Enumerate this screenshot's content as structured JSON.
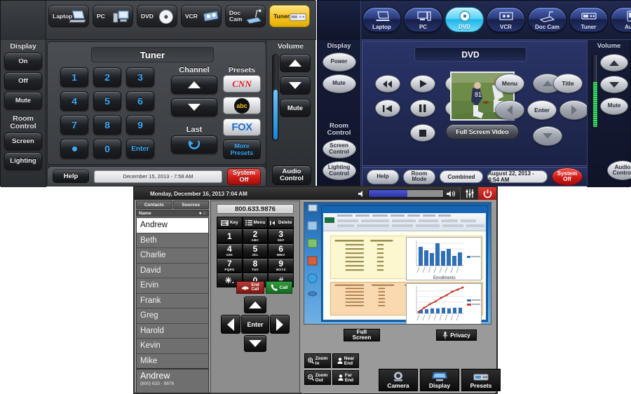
{
  "panel1": {
    "sources": [
      {
        "label": "Laptop",
        "icon": "laptop-icon",
        "selected": false
      },
      {
        "label": "PC",
        "icon": "desktop-pc-icon",
        "selected": false
      },
      {
        "label": "DVD",
        "icon": "disc-icon",
        "selected": false
      },
      {
        "label": "VCR",
        "icon": "vcr-tape-icon",
        "selected": false
      },
      {
        "label": "Doc\nCam",
        "icon": "document-camera-icon",
        "selected": false
      },
      {
        "label": "Tuner",
        "icon": "tuner-receiver-icon",
        "selected": true
      }
    ],
    "left": {
      "display_header": "Display",
      "display_buttons": [
        "On",
        "Off",
        "Mute"
      ],
      "room_header": "Room\nControl",
      "room_buttons": [
        "Screen",
        "Lighting"
      ]
    },
    "title": "Tuner",
    "keypad": [
      "1",
      "2",
      "3",
      "4",
      "5",
      "6",
      "7",
      "8",
      "9",
      "•",
      "0",
      "Enter"
    ],
    "channel_label": "Channel",
    "last_label": "Last",
    "presets_label": "Presets",
    "presets": [
      "CNN",
      "abc",
      "FOX"
    ],
    "more_presets": "More\nPresets",
    "bottom": {
      "help": "Help",
      "datetime": "December 15, 2013   -  7:58 AM",
      "system_off": "System\nOff"
    },
    "right": {
      "volume_header": "Volume",
      "mute": "Mute",
      "audio_control": "Audio\nControl",
      "volume_level_pct": 58
    }
  },
  "panel2": {
    "sources": [
      {
        "label": "Laptop",
        "icon": "laptop-icon",
        "selected": false
      },
      {
        "label": "PC",
        "icon": "desktop-pc-icon",
        "selected": false
      },
      {
        "label": "DVD",
        "icon": "disc-icon",
        "selected": true
      },
      {
        "label": "VCR",
        "icon": "vcr-tape-icon",
        "selected": false
      },
      {
        "label": "Doc Cam",
        "icon": "document-camera-icon",
        "selected": false
      },
      {
        "label": "Tuner",
        "icon": "tuner-receiver-icon",
        "selected": false
      },
      {
        "label": "Aux",
        "icon": "aux-device-icon",
        "selected": false
      }
    ],
    "left": {
      "display_header": "Display",
      "display_buttons": [
        "Power",
        "Mute"
      ],
      "room_header": "Room\nControl",
      "room_buttons": [
        "Screen\nControl",
        "Lighting\nControl"
      ]
    },
    "title": "DVD",
    "transport": [
      "rewind-icon",
      "play-icon",
      "fast-forward-icon",
      "previous-track-icon",
      "pause-icon",
      "next-track-icon",
      "stop-icon"
    ],
    "menu": "Menu",
    "title_btn": "Title",
    "enter": "Enter",
    "full_screen_video": "Full Screen Video",
    "bottom": {
      "help": "Help",
      "room_mode": "Room\nMode",
      "combined": "Combined",
      "datetime": "August 22, 2013  -  4:54 AM",
      "system_off": "System\nOff"
    },
    "right": {
      "volume_header": "Volume",
      "mute": "Mute",
      "audio_control": "Audio\nControl",
      "volume_level_pct": 62
    }
  },
  "panel3": {
    "topbar": {
      "datetime": "Monday, December 16, 2013 7:04 AM",
      "volume_pct": 52,
      "speaker_low_icon": "speaker-low-icon",
      "speaker_high_icon": "speaker-high-icon",
      "settings_icon": "sliders-icon",
      "power_icon": "power-icon"
    },
    "tabs": [
      "Contacts",
      "Sources"
    ],
    "name_header": "Name",
    "contacts": [
      "Andrew",
      "Beth",
      "Charlie",
      "David",
      "Ervin",
      "Frank",
      "Greg",
      "Harold",
      "Kevin",
      "Mike"
    ],
    "selected_contact": "Andrew",
    "footer": {
      "name": "Andrew",
      "number": "(800) 633 - 9876"
    },
    "dialed_number": "800.633.9876",
    "dial_tools": [
      {
        "label": "Key",
        "icon": "keyboard-icon"
      },
      {
        "label": "Menu",
        "icon": "list-menu-icon"
      },
      {
        "label": "Delete",
        "icon": "backspace-icon"
      }
    ],
    "keypad": [
      {
        "big": "1",
        "sub": ""
      },
      {
        "big": "2",
        "sub": "ABC"
      },
      {
        "big": "3",
        "sub": "DEF"
      },
      {
        "big": "4",
        "sub": "GHI"
      },
      {
        "big": "5",
        "sub": "JKL"
      },
      {
        "big": "6",
        "sub": "MNO"
      },
      {
        "big": "7",
        "sub": "PQRS"
      },
      {
        "big": "8",
        "sub": "TUV"
      },
      {
        "big": "9",
        "sub": "WXYZ"
      },
      {
        "big": "✳.",
        "sub": ""
      },
      {
        "big": "0",
        "sub": ""
      },
      {
        "big": "#",
        "sub": ""
      }
    ],
    "end_call": "End\nCall",
    "call": "Call",
    "enter": "Enter",
    "full_screen": "Full\nScreen",
    "privacy": "Privacy",
    "camera_controls": [
      {
        "label": "Zoom\nIn",
        "icon": "zoom-in-icon"
      },
      {
        "label": "Near\nEnd",
        "icon": "person-icon"
      },
      {
        "label": "Zoom\nOut",
        "icon": "zoom-out-icon"
      },
      {
        "label": "Far\nEnd",
        "icon": "person-icon"
      }
    ],
    "mode_buttons": [
      {
        "label": "Camera",
        "icon": "video-camera-icon"
      },
      {
        "label": "Display",
        "icon": "monitor-icon"
      },
      {
        "label": "Presets",
        "icon": "presets-icon"
      }
    ],
    "screen_share": {
      "app": "Excel spreadsheet with Enrollments bar chart and line chart"
    }
  },
  "colors": {
    "panel1_accent": "#3fa9f5",
    "panel1_selected_source": "#f6c324",
    "panel2_accent": "#5fd4f5",
    "system_off_red": "#cf1b16",
    "call_green": "#2f9a3c",
    "end_call_red": "#b23b38"
  }
}
